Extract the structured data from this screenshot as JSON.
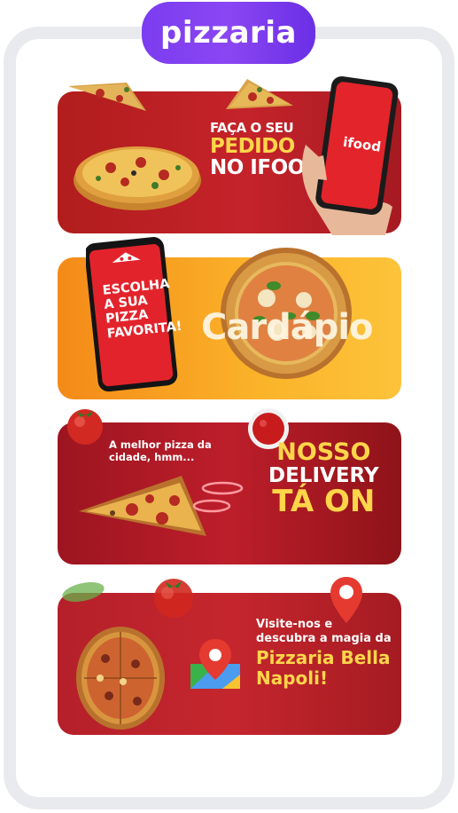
{
  "header": {
    "badge_label": "pizzaria"
  },
  "banners": [
    {
      "headline_line1": "FAÇA O SEU",
      "headline_line2": "PEDIDO",
      "headline_line3": "NO IFOOD",
      "phone_logo": "ifood"
    },
    {
      "phone_text_line1": "ESCOLHA",
      "phone_text_line2": "A SUA",
      "phone_text_line3": "PIZZA",
      "phone_text_line4": "FAVORITA!",
      "word": "Cardápio"
    },
    {
      "tagline_line1": "A melhor pizza da",
      "tagline_line2": "cidade, hmm...",
      "headline_line1": "NOSSO",
      "headline_line2": "DELIVERY",
      "headline_line3": "TÁ ON"
    },
    {
      "intro_line1": "Visite-nos e",
      "intro_line2": "descubra a magia da",
      "name_line1": "Pizzaria Bella",
      "name_line2": "Napoli!"
    }
  ],
  "colors": {
    "badge": "#7b3df0",
    "banner_red": "#c4232a",
    "banner_orange": "#f9a826",
    "headline_yellow": "#ffd54a",
    "frame": "#e9eaee"
  },
  "icons": [
    "pizza-icon",
    "phone-icon",
    "tomato-icon",
    "sauce-bowl-icon",
    "map-pin-icon",
    "maps-app-icon",
    "basil-leaf-icon"
  ]
}
